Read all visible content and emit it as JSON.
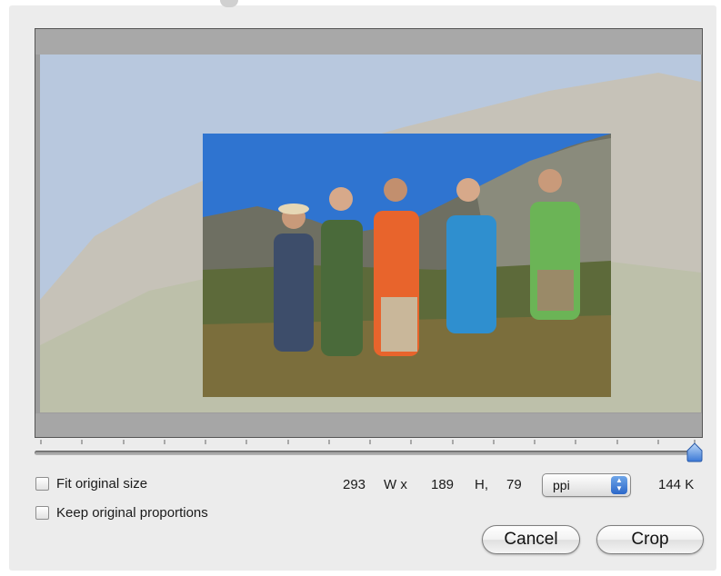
{
  "options": {
    "fit_original_size_label": "Fit original size",
    "fit_original_size_checked": false,
    "keep_proportions_label": "Keep original proportions",
    "keep_proportions_checked": false
  },
  "dimensions": {
    "width_value": "293",
    "width_unit": "W x",
    "height_value": "189",
    "height_unit": "H,",
    "resolution_value": "79",
    "resolution_unit": "ppi",
    "file_size": "144 K"
  },
  "slider": {
    "level": 1.0
  },
  "buttons": {
    "cancel_label": "Cancel",
    "crop_label": "Crop"
  },
  "colors": {
    "accent": "#3a78d6",
    "dialog_bg": "#ececec"
  }
}
